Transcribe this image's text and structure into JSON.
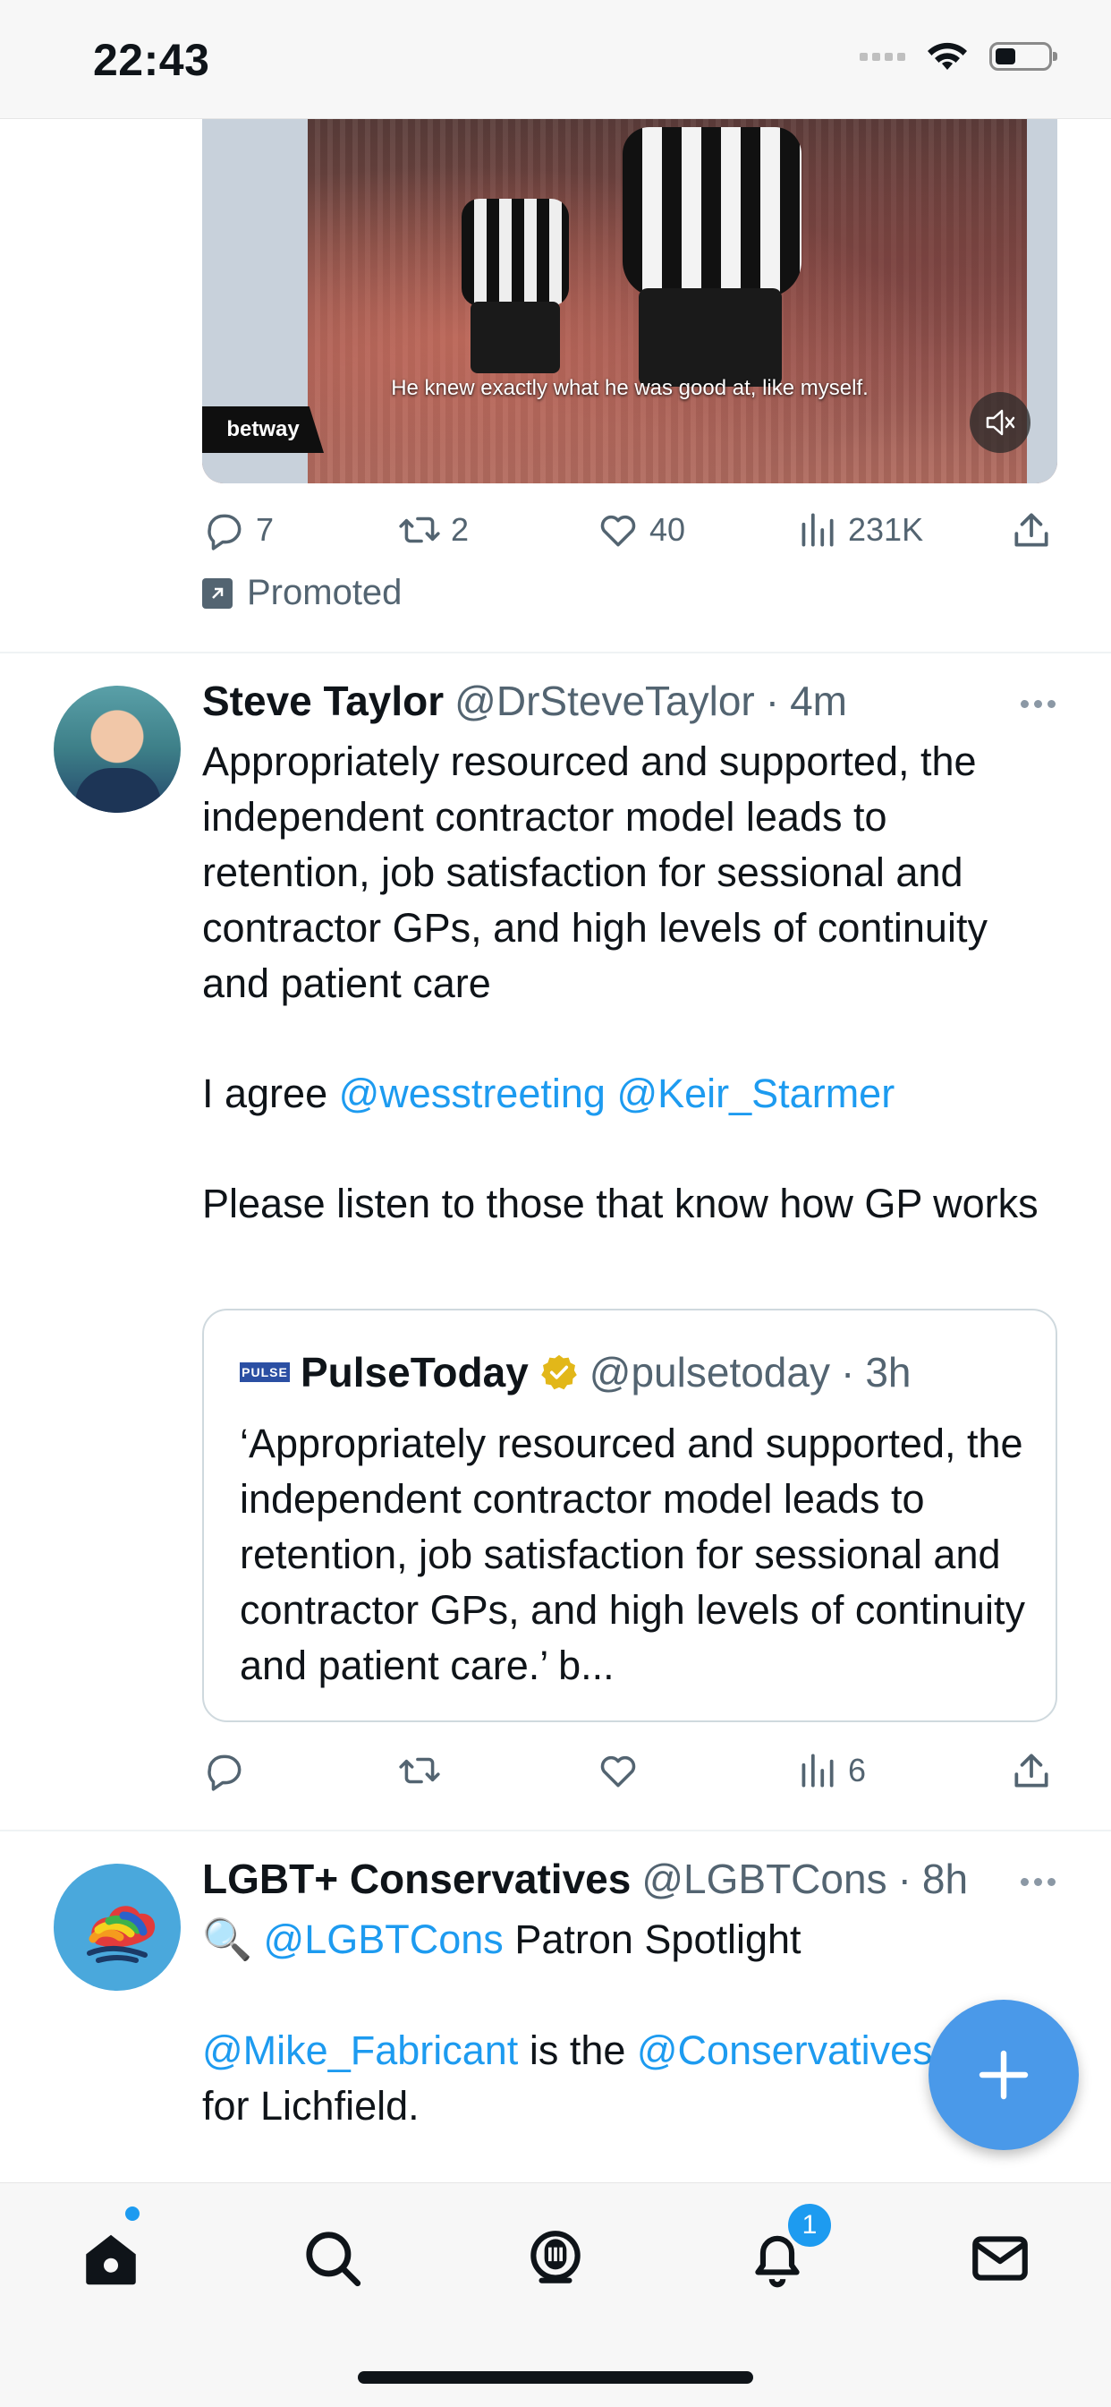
{
  "status": {
    "time": "22:43"
  },
  "ad": {
    "caption": "He knew exactly what he was good at, like myself.",
    "sponsor": "betway",
    "actions": {
      "replies": "7",
      "retweets": "2",
      "likes": "40",
      "views": "231K"
    },
    "promoted_label": "Promoted"
  },
  "tweet1": {
    "name": "Steve Taylor",
    "handle": "@DrSteveTaylor",
    "time": "4m",
    "line1": "Appropriately resourced and supported, the independent contractor model leads to retention, job satisfaction for sessional and contractor GPs, and high levels of continuity and patient care",
    "agree_prefix": "I agree ",
    "mention1": "@wesstreeting",
    "mention2": "@Keir_Starmer",
    "line3": "Please listen to those that know how GP works",
    "quote": {
      "logo": "PULSE",
      "name": "PulseToday",
      "handle": "@pulsetoday",
      "time": "3h",
      "text": "‘Appropriately resourced and supported, the independent contractor model leads to retention, job satisfaction for sessional and contractor GPs, and high levels of continuity and patient care.’ b..."
    },
    "actions": {
      "views": "6"
    }
  },
  "tweet2": {
    "name": "LGBT+ Conservatives",
    "handle": "@LGBTCons",
    "time": "8h",
    "emoji": "🔍",
    "mention1": "@LGBTCons",
    "text1": " Patron Spotlight",
    "mention2": "@Mike_Fabricant",
    "text2": " is the ",
    "mention3": "@Conservatives",
    "text3": "for Lichfield."
  },
  "tabbar": {
    "notifications_badge": "1"
  },
  "colors": {
    "accent": "#1d9bf0",
    "fab": "#4a99e9",
    "secondary_text": "#536471"
  }
}
